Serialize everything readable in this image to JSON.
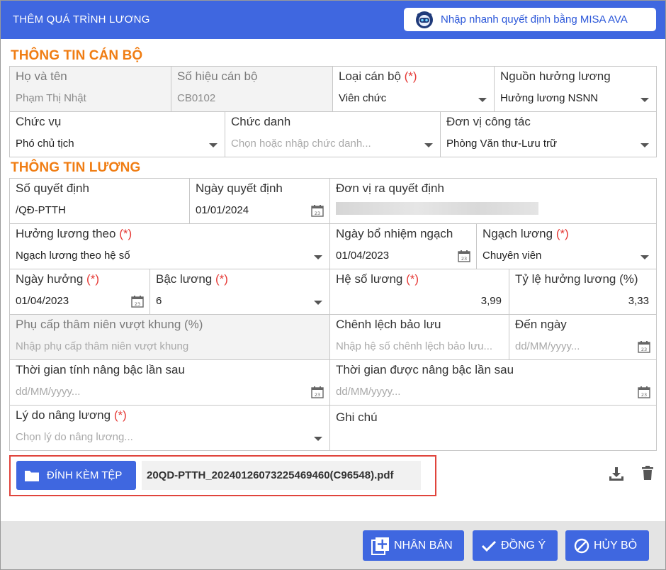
{
  "header": {
    "title": "THÊM QUÁ TRÌNH LƯƠNG",
    "ava_button": "Nhập nhanh quyết định bằng MISA AVA"
  },
  "sections": {
    "staff_info": "THÔNG TIN CÁN BỘ",
    "salary_info": "THÔNG TIN LƯƠNG"
  },
  "required_mark": "(*)",
  "fields": {
    "full_name": {
      "label": "Họ và tên",
      "value": "Phạm Thị Nhật"
    },
    "staff_code": {
      "label": "Số hiệu cán bộ",
      "value": "CB0102"
    },
    "staff_type": {
      "label": "Loại cán bộ",
      "value": "Viên chức"
    },
    "salary_source": {
      "label": "Nguồn hưởng lương",
      "value": "Hưởng lương NSNN"
    },
    "position": {
      "label": "Chức vụ",
      "value": "Phó chủ tịch"
    },
    "title": {
      "label": "Chức danh",
      "placeholder": "Chọn hoặc nhập chức danh..."
    },
    "work_unit": {
      "label": "Đơn vị công tác",
      "value": "Phòng Văn thư-Lưu trữ"
    },
    "decision_no": {
      "label": "Số quyết định",
      "value": "/QĐ-PTTH"
    },
    "decision_date": {
      "label": "Ngày quyết định",
      "value": "01/01/2024"
    },
    "issuing_unit": {
      "label": "Đơn vị ra quyết định"
    },
    "salary_basis": {
      "label": "Hưởng lương theo",
      "value": "Ngạch lương theo hệ số"
    },
    "appointment_date": {
      "label": "Ngày bổ nhiệm ngạch",
      "value": "01/04/2023"
    },
    "salary_grade": {
      "label": "Ngạch lương",
      "value": "Chuyên viên"
    },
    "effective_date": {
      "label": "Ngày hưởng",
      "value": "01/04/2023"
    },
    "salary_step": {
      "label": "Bậc lương",
      "value": "6"
    },
    "coefficient": {
      "label": "Hệ số lương",
      "value": "3,99"
    },
    "salary_rate": {
      "label": "Tỷ lệ hưởng lương (%)",
      "value": "3,33"
    },
    "seniority_allowance": {
      "label": "Phụ cấp thâm niên vượt khung (%)",
      "placeholder": "Nhập phụ cấp thâm niên vượt khung"
    },
    "reserved_diff": {
      "label": "Chênh lệch bảo lưu",
      "placeholder": "Nhập hệ số chênh lệch bảo lưu..."
    },
    "to_date": {
      "label": "Đến ngày",
      "placeholder": "dd/MM/yyyy..."
    },
    "next_raise_calc": {
      "label": "Thời gian tính nâng bậc lần sau",
      "placeholder": "dd/MM/yyyy..."
    },
    "next_raise": {
      "label": "Thời gian được nâng bậc lần sau",
      "placeholder": "dd/MM/yyyy..."
    },
    "raise_reason": {
      "label": "Lý do nâng lương",
      "placeholder": "Chọn lý do nâng lương..."
    },
    "note": {
      "label": "Ghi chú"
    }
  },
  "attachment": {
    "button": "ĐÍNH KÈM TỆP",
    "file_name": "20QD-PTTH_20240126073225469460(C96548).pdf"
  },
  "footer": {
    "duplicate": "NHÂN BẢN",
    "agree": "ĐỒNG Ý",
    "cancel": "HỦY BỎ"
  },
  "calendar_day": "23",
  "colors": {
    "primary": "#3f67e0",
    "section_title": "#f07d13",
    "required": "#e53935",
    "highlight_border": "#e0443c"
  }
}
